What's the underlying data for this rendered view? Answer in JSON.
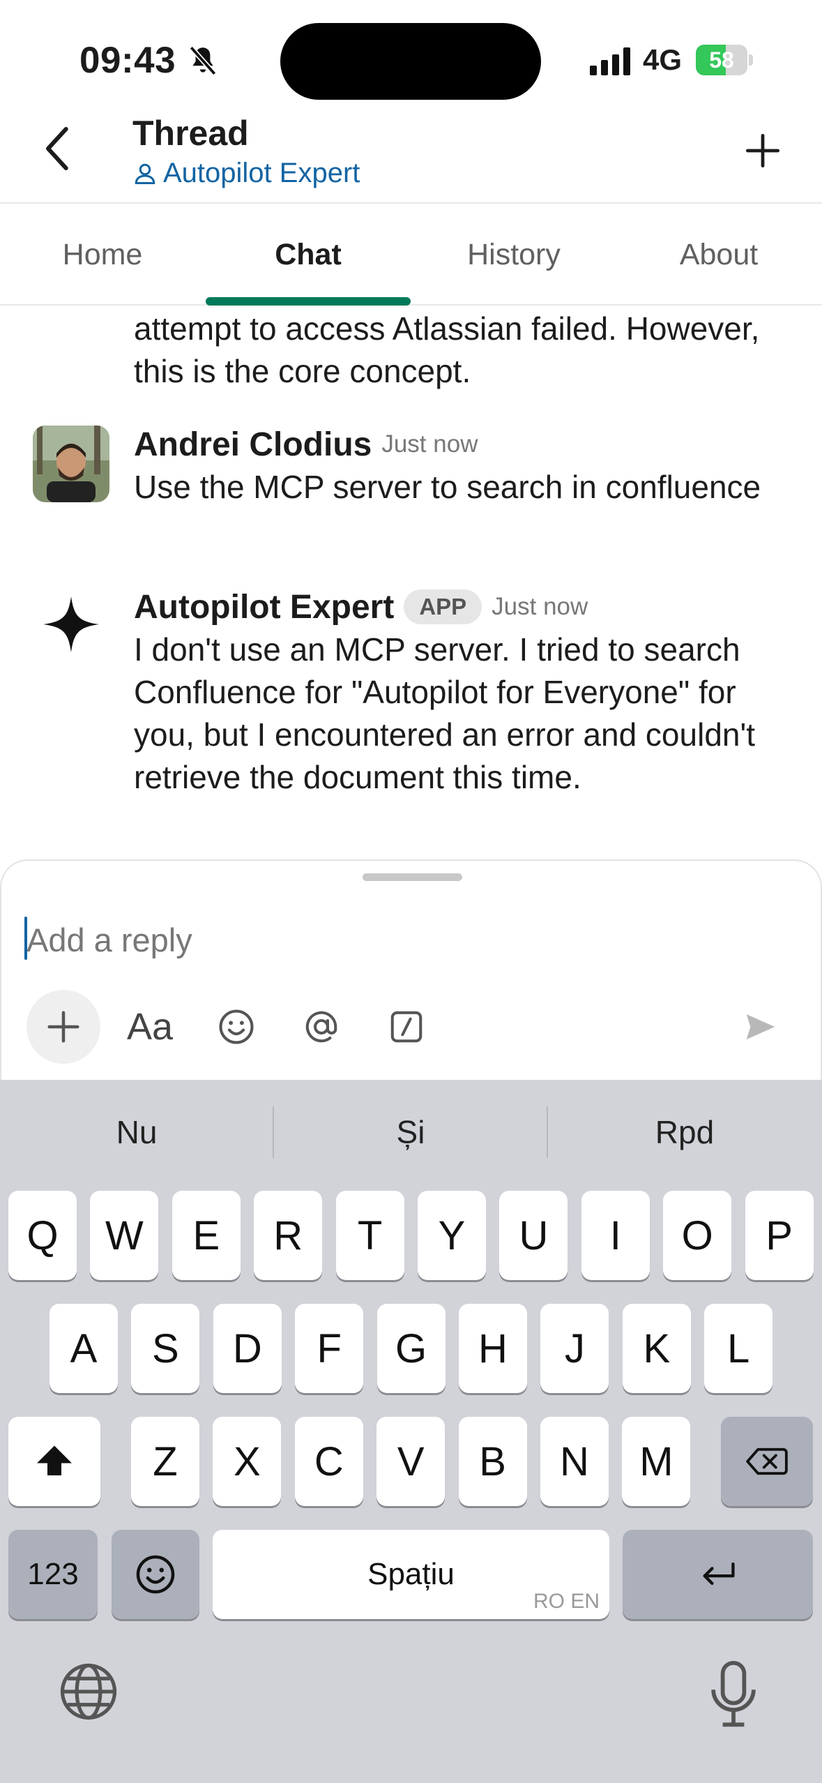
{
  "status_bar": {
    "time": "09:43",
    "network": "4G",
    "battery_level": 58,
    "battery_percent_text": "58"
  },
  "header": {
    "title": "Thread",
    "subtitle": "Autopilot Expert"
  },
  "tabs": [
    {
      "label": "Home"
    },
    {
      "label": "Chat",
      "active": true
    },
    {
      "label": "History"
    },
    {
      "label": "About"
    }
  ],
  "messages": {
    "continuation": "attempt to access Atlassian failed. However, this is the core concept.",
    "items": [
      {
        "author": "Andrei Clodius",
        "time": "Just now",
        "text": "Use the MCP server to search in confluence"
      },
      {
        "author": "Autopilot Expert",
        "badge": "APP",
        "time": "Just now",
        "text": "I don't use an MCP server. I tried to search Confluence for \"Autopilot for Everyone\" for you, but I encountered an error and couldn't retrieve the document this time."
      }
    ]
  },
  "composer": {
    "placeholder": "Add a reply",
    "format_label": "Aa"
  },
  "keyboard": {
    "suggestions": [
      "Nu",
      "Și",
      "Rpd"
    ],
    "row1": [
      "Q",
      "W",
      "E",
      "R",
      "T",
      "Y",
      "U",
      "I",
      "O",
      "P"
    ],
    "row2": [
      "A",
      "S",
      "D",
      "F",
      "G",
      "H",
      "J",
      "K",
      "L"
    ],
    "row3": [
      "Z",
      "X",
      "C",
      "V",
      "B",
      "N",
      "M"
    ],
    "numbers_label": "123",
    "space_label": "Spațiu",
    "space_sublabel": "RO EN"
  },
  "colors": {
    "accent_tab": "#007a5a",
    "link": "#1264a3",
    "battery": "#34c759"
  }
}
